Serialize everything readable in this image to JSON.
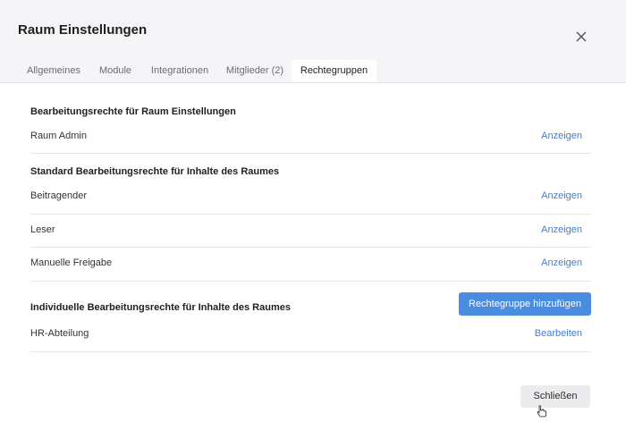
{
  "dialog": {
    "title": "Raum Einstellungen",
    "close_icon": "close-icon"
  },
  "tabs": [
    {
      "label": "Allgemeines",
      "active": false
    },
    {
      "label": "Module",
      "active": false
    },
    {
      "label": "Integrationen",
      "active": false
    },
    {
      "label": "Mitglieder (2)",
      "active": false
    },
    {
      "label": "Rechtegruppen",
      "active": true
    }
  ],
  "sections": {
    "room_rights": {
      "title": "Bearbeitungsrechte für Raum Einstellungen",
      "rows": [
        {
          "label": "Raum Admin",
          "action": "Anzeigen"
        }
      ]
    },
    "standard_rights": {
      "title": "Standard Bearbeitungsrechte für Inhalte des Raumes",
      "rows": [
        {
          "label": "Beitragender",
          "action": "Anzeigen"
        },
        {
          "label": "Leser",
          "action": "Anzeigen"
        },
        {
          "label": "Manuelle Freigabe",
          "action": "Anzeigen"
        }
      ]
    },
    "individual_rights": {
      "title": "Individuelle Bearbeitungsrechte für Inhalte des Raumes",
      "add_button": "Rechtegruppe hinzufügen",
      "rows": [
        {
          "label": "HR-Abteilung",
          "action": "Bearbeiten"
        }
      ]
    }
  },
  "footer": {
    "close_button": "Schließen"
  },
  "colors": {
    "accent": "#4a8de0",
    "link": "#3d7ed6",
    "header_bg": "#f5f5f7"
  }
}
